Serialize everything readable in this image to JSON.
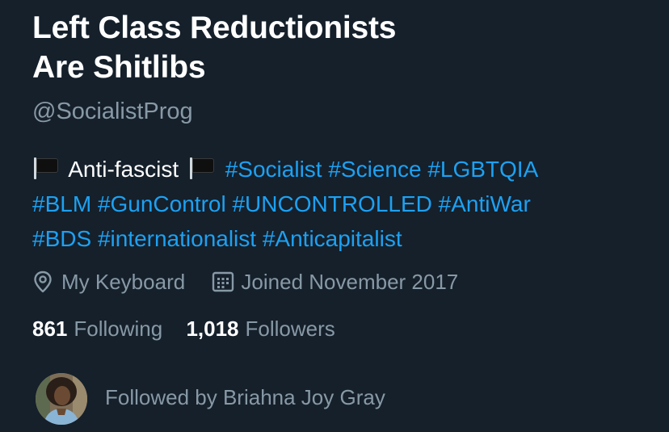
{
  "profile": {
    "display_name_line1": "Left Class Reductionists",
    "display_name_line2": "Are Shitlibs",
    "handle": "@SocialistProg",
    "bio": {
      "flag_icon": "black-flag-icon",
      "text": "Anti-fascist",
      "hashtags_line1": [
        "#Socialist",
        "#Science",
        "#LGBTQIA"
      ],
      "hashtags_line2": [
        "#BLM",
        "#GunControl",
        "#UNCONTROLLED",
        "#AntiWar"
      ],
      "hashtags_line3": [
        "#BDS",
        "#internationalist",
        "#Anticapitalist"
      ]
    },
    "location": "My Keyboard",
    "location_icon": "location-pin-icon",
    "joined": "Joined November 2017",
    "joined_icon": "calendar-icon",
    "following_count": "861",
    "following_label": "Following",
    "followers_count": "1,018",
    "followers_label": "Followers",
    "followed_by": "Followed by Briahna Joy Gray"
  },
  "colors": {
    "background": "#15202b",
    "primary_text": "#ffffff",
    "secondary_text": "#8899a6",
    "link": "#1da1f2"
  }
}
